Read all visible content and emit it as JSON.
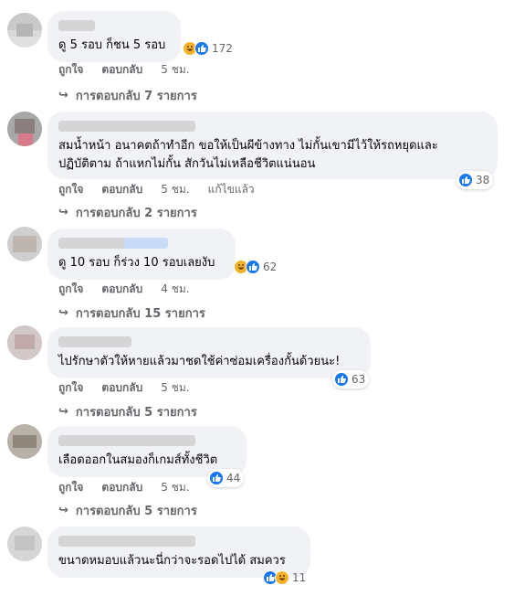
{
  "comments": [
    {
      "text_lines": [
        "ดู 5 รอบ ก็ชน 5 รอบ"
      ],
      "reactions": [
        "haha",
        "like"
      ],
      "count": "172",
      "actions": [
        "ถูกใจ",
        "ตอบกลับ"
      ],
      "time": "5 ชม.",
      "edited": "",
      "replies": "การตอบกลับ 7 รายการ"
    },
    {
      "text_lines": [
        "สมน้ำหน้า อนาคตถ้าทำอีก ขอให้เป็นผีข้างทาง ไม่กั้นเขามีไว้ให้รถหยุดและ",
        "ปฏิบัติตาม ถ้าแหกไม่กั้น สักวันไม่เหลือชีวิตแน่นอน"
      ],
      "reactions": [
        "like"
      ],
      "count": "38",
      "actions": [
        "ถูกใจ",
        "ตอบกลับ"
      ],
      "time": "5 ชม.",
      "edited": "แก้ไขแล้ว",
      "replies": "การตอบกลับ 2 รายการ"
    },
    {
      "text_lines": [
        "ดู 10 รอบ ก็ร่วง 10 รอบเลยงับ"
      ],
      "reactions": [
        "haha",
        "like"
      ],
      "count": "62",
      "actions": [
        "ถูกใจ",
        "ตอบกลับ"
      ],
      "time": "4 ชม.",
      "edited": "",
      "replies": "การตอบกลับ 15 รายการ"
    },
    {
      "text_lines": [
        "ไปรักษาตัวให้หายแล้วมาชดใช้ค่าซ่อมเครื่องกั้นด้วยนะ!"
      ],
      "reactions": [
        "like"
      ],
      "count": "63",
      "actions": [
        "ถูกใจ",
        "ตอบกลับ"
      ],
      "time": "5 ชม.",
      "edited": "",
      "replies": "การตอบกลับ 5 รายการ"
    },
    {
      "text_lines": [
        "เลือดออกในสมองก็เกมส์ทั้งชีวิต"
      ],
      "reactions": [
        "like"
      ],
      "count": "44",
      "actions": [
        "ถูกใจ",
        "ตอบกลับ"
      ],
      "time": "5 ชม.",
      "edited": "",
      "replies": "การตอบกลับ 5 รายการ"
    },
    {
      "text_lines": [
        "ขนาดหมอบแล้วนะนี่กว่าจะรอดไปได้ สมควร"
      ],
      "reactions": [
        "like",
        "haha"
      ],
      "count": "11",
      "actions": [],
      "time": "",
      "edited": "",
      "replies": ""
    }
  ],
  "colors": {
    "like": "#1877f2",
    "haha": "#f7b125",
    "bubble": "#f0f2f5",
    "meta": "#65676b"
  }
}
